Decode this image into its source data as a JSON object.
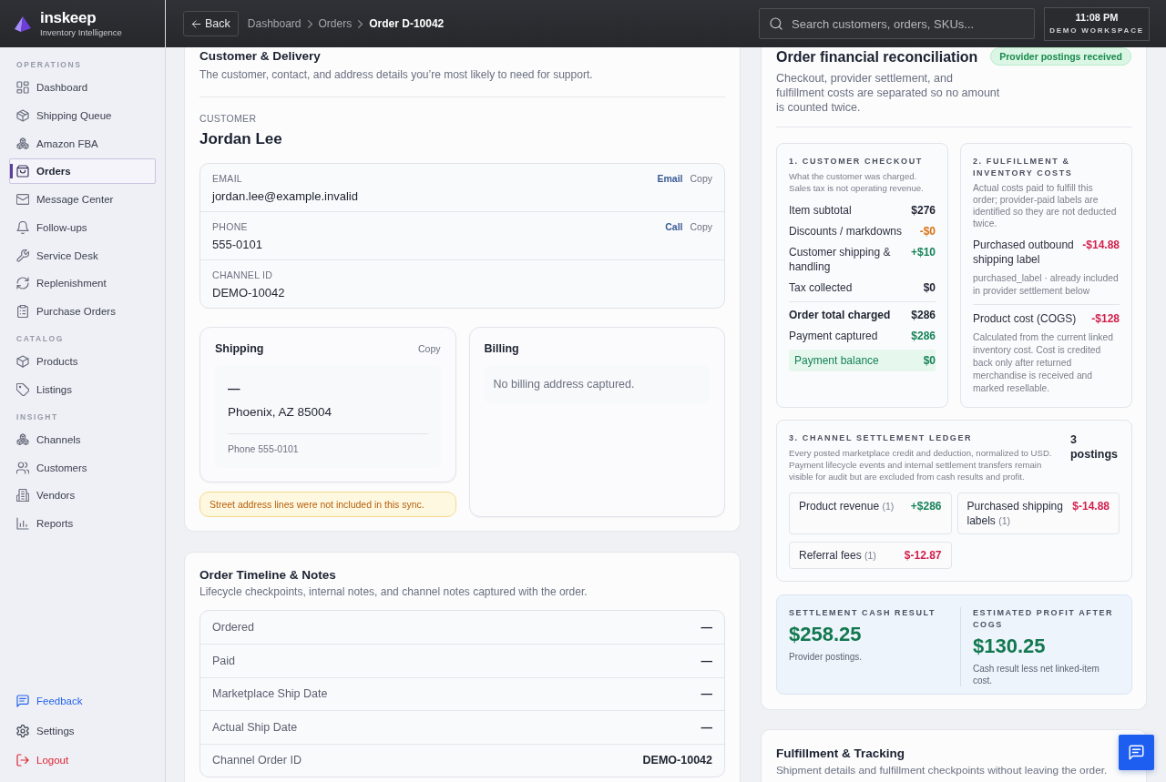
{
  "sidebar": {
    "brand": {
      "name": "inskeep",
      "tagline": "Inventory Intelligence"
    },
    "sections": [
      {
        "heading": "OPERATIONS",
        "items": [
          {
            "label": "Dashboard",
            "selected": false
          },
          {
            "label": "Shipping Queue",
            "selected": false
          },
          {
            "label": "Amazon FBA",
            "selected": false
          },
          {
            "label": "Orders",
            "selected": true
          },
          {
            "label": "Message Center",
            "selected": false
          },
          {
            "label": "Follow-ups",
            "selected": false
          },
          {
            "label": "Service Desk",
            "selected": false
          },
          {
            "label": "Replenishment",
            "selected": false
          },
          {
            "label": "Purchase Orders",
            "selected": false
          }
        ]
      },
      {
        "heading": "CATALOG",
        "items": [
          {
            "label": "Products",
            "selected": false
          },
          {
            "label": "Listings",
            "selected": false
          }
        ]
      },
      {
        "heading": "INSIGHT",
        "items": [
          {
            "label": "Channels",
            "selected": false
          },
          {
            "label": "Customers",
            "selected": false
          },
          {
            "label": "Vendors",
            "selected": false
          },
          {
            "label": "Reports",
            "selected": false
          }
        ]
      }
    ],
    "footer_items": [
      {
        "label": "Feedback",
        "color": "#2563eb"
      },
      {
        "label": "Settings",
        "color": "#3b4050"
      },
      {
        "label": "Logout",
        "color": "#dc2635"
      }
    ]
  },
  "top_bar": {
    "back_button": "Back",
    "breadcrumb": [
      {
        "label": "Dashboard",
        "current": false
      },
      {
        "label": "Orders",
        "current": false
      },
      {
        "label": "Order D-10042",
        "current": true
      }
    ],
    "search": {
      "placeholder": "Search customers, orders, SKUs..."
    },
    "clock": {
      "time": "11:08 PM",
      "workspace": "DEMO WORKSPACE"
    }
  },
  "customer_delivery": {
    "title": "Customer & Delivery",
    "subtitle": "The customer, contact, and address details you’re most likely to need for support.",
    "customer_label": "CUSTOMER",
    "customer_name": "Jordan Lee",
    "contacts": [
      {
        "label": "EMAIL",
        "value": "jordan.lee@example.invalid",
        "actions": [
          {
            "label": "Email",
            "kind": "primary"
          },
          {
            "label": "Copy",
            "kind": "secondary"
          }
        ]
      },
      {
        "label": "PHONE",
        "value": "555-0101",
        "actions": [
          {
            "label": "Call",
            "kind": "primary"
          },
          {
            "label": "Copy",
            "kind": "secondary"
          }
        ]
      },
      {
        "label": "CHANNEL ID",
        "value": "DEMO-10042"
      }
    ],
    "shipping": {
      "title": "Shipping",
      "action": "Copy",
      "lines": [
        "—",
        "Phoenix, AZ 85004"
      ],
      "phone": "Phone 555-0101",
      "warning": "Street address lines were not included in this sync."
    },
    "billing": {
      "title": "Billing",
      "empty_message": "No billing address captured."
    }
  },
  "order_timeline": {
    "title": "Order Timeline & Notes",
    "subtitle": "Lifecycle checkpoints, internal notes, and channel notes captured with the order.",
    "rows": [
      {
        "label": "Ordered",
        "value": "—"
      },
      {
        "label": "Paid",
        "value": "—"
      },
      {
        "label": "Marketplace Ship Date",
        "value": "—"
      },
      {
        "label": "Actual Ship Date",
        "value": "—"
      },
      {
        "label": "Channel Order ID",
        "value": "DEMO-10042"
      }
    ]
  },
  "reconciliation": {
    "title": "Order financial reconciliation",
    "badge": "Provider postings received",
    "subtitle": "Checkout, provider settlement, and fulfillment costs are separated so no amount is counted twice.",
    "checkout": {
      "title": "1. CUSTOMER CHECKOUT",
      "description": "What the customer was charged. Sales tax is not operating revenue.",
      "rows": [
        {
          "kind": "line",
          "label": "Item subtotal",
          "value": "$276",
          "color": "#1d2330"
        },
        {
          "kind": "line",
          "label": "Discounts / markdowns",
          "value": "-$0",
          "color": "#d97316"
        },
        {
          "kind": "line",
          "label": "Customer shipping & handling",
          "value": "+$10",
          "color": "#16835a"
        },
        {
          "kind": "line",
          "label": "Tax collected",
          "value": "$0",
          "color": "#1d2330"
        },
        {
          "kind": "total",
          "label": "Order total charged",
          "value": "$286",
          "color": "#1d2330"
        },
        {
          "kind": "line",
          "label": "Payment captured",
          "value": "$286",
          "color": "#16835a"
        },
        {
          "kind": "balance",
          "label": "Payment balance",
          "value": "$0",
          "color": "#16835a"
        }
      ]
    },
    "fulfillment": {
      "title": "2. FULFILLMENT & INVENTORY COSTS",
      "description": "Actual costs paid to fulfill this order; provider-paid labels are identified so they are not deducted twice.",
      "rows": [
        {
          "label": "Purchased outbound shipping label",
          "value": "-$14.88",
          "note": "purchased_label · already included in provider settlement below"
        },
        {
          "label": "Product cost (COGS)",
          "value": "-$128",
          "note": "Calculated from the current linked inventory cost. Cost is credited back only after returned merchandise is received and marked resellable."
        }
      ]
    },
    "ledger": {
      "title": "3. CHANNEL SETTLEMENT LEDGER",
      "description": "Every posted marketplace credit and deduction, normalized to USD. Payment lifecycle events and internal settlement transfers remain visible for audit but are excluded from cash results and profit.",
      "count": "3 postings",
      "entries": [
        {
          "label": "Product revenue",
          "count": "(1)",
          "value": "+$286",
          "color": "#16835a"
        },
        {
          "label": "Purchased shipping labels",
          "count": "(1)",
          "value": "$-14.88",
          "color": "#d21f4b"
        },
        {
          "label": "Referral fees",
          "count": "(1)",
          "value": "$-12.87",
          "color": "#d21f4b"
        }
      ]
    },
    "results": [
      {
        "label": "SETTLEMENT CASH RESULT",
        "value": "$258.25",
        "note": "Provider postings."
      },
      {
        "label": "ESTIMATED PROFIT AFTER COGS",
        "value": "$130.25",
        "note": "Cash result less net linked-item cost."
      }
    ]
  },
  "fulfillment_tracking": {
    "title": "Fulfillment & Tracking",
    "subtitle": "Shipment details and fulfillment checkpoints without leaving the order."
  }
}
